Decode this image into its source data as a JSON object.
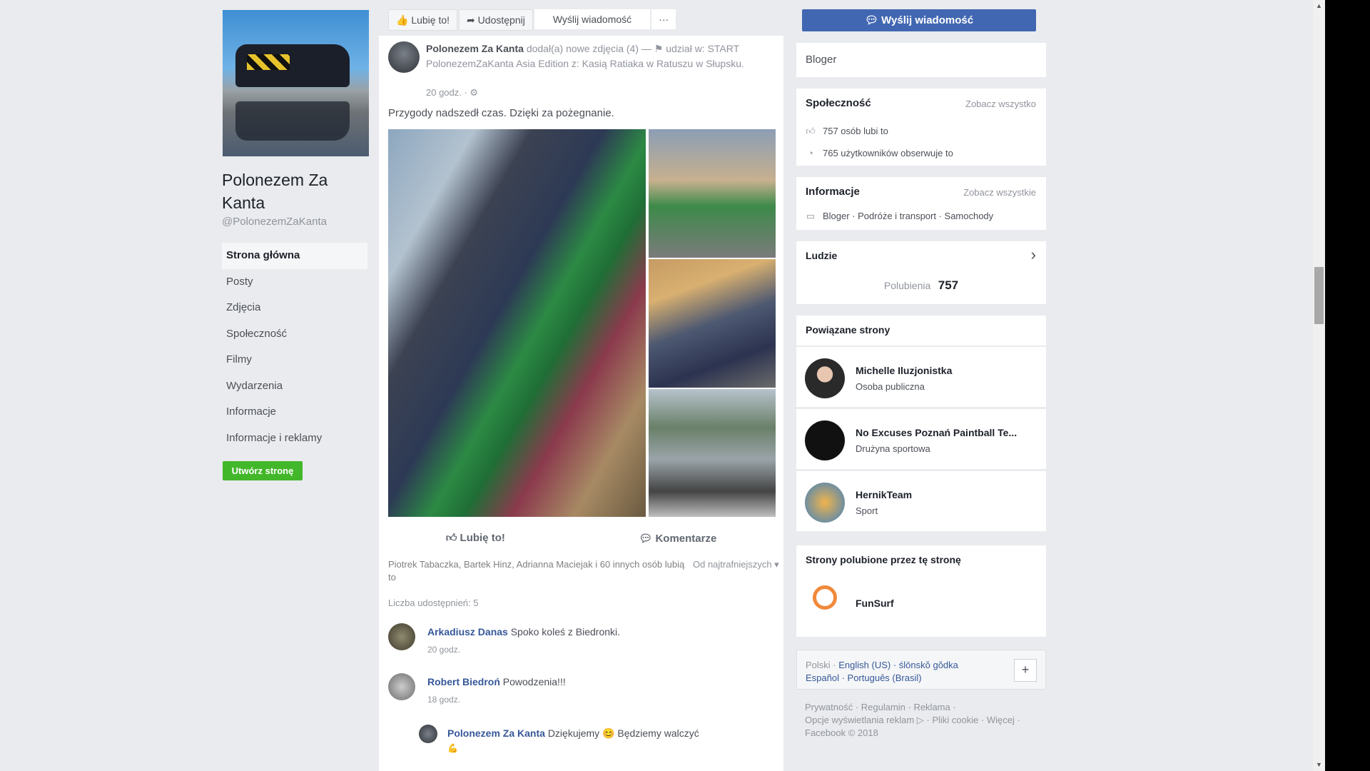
{
  "colors": {
    "accent": "#4267b2",
    "green": "#42b72a",
    "link": "#365899"
  },
  "page": {
    "name": "Polonezem Za Kanta",
    "handle": "@PolonezemZaKanta"
  },
  "nav": {
    "items": [
      "Strona główna",
      "Posty",
      "Zdjęcia",
      "Społeczność",
      "Filmy",
      "Wydarzenia",
      "Informacje",
      "Informacje i reklamy"
    ],
    "active": "Strona główna"
  },
  "create_button": "Utwórz stronę",
  "actionbar": {
    "like": "Lubię to!",
    "share": "Udostępnij",
    "message": "Wyślij wiadomość",
    "more": "···"
  },
  "post": {
    "author": "Polonezem Za Kanta",
    "header_text": "dodał(a) nowe zdjęcia (4) — ⚑ udział w: START PolonezemZaKanta Asia Edition z: Kasią Ratiaka w Ratuszu w Słupsku.",
    "time": "20 godz. · ⚙",
    "text": "Przygody nadszedł czas. Dzięki za pożegnanie.",
    "like_label": "Lubię to!",
    "comment_label": "Komentarze",
    "likes_text": "Piotrek Tabaczka, Bartek Hinz, Adrianna Maciejak i 60 innych osób lubią to",
    "sort_label": "Od najtrafniejszych ▾",
    "shares_text": "Liczba udostępnień: 5",
    "comments": [
      {
        "author": "Arkadiusz Danas",
        "text": "Spoko koleś z Biedronki.",
        "time": "20 godz."
      },
      {
        "author": "Robert Biedroń",
        "text": "Powodzenia!!!",
        "time": "18 godz."
      },
      {
        "author": "Polonezem Za Kanta",
        "text": "Dziękujemy 😊 Będziemy walczyć",
        "time": "💪"
      }
    ]
  },
  "right": {
    "send_button": "Wyślij wiadomość",
    "category": "Bloger",
    "community": {
      "title": "Społeczność",
      "see_all": "Zobacz wszystko",
      "likes": "757 osób lubi to",
      "follows": "765 użytkowników obserwuje to"
    },
    "info": {
      "title": "Informacje",
      "see_all": "Zobacz wszystkie",
      "categories": "Bloger · Podróże i transport · Samochody"
    },
    "people": {
      "title": "Ludzie",
      "likes_label": "Polubienia",
      "likes_value": "757",
      "arrow": "›"
    },
    "related": {
      "title": "Powiązane strony",
      "items": [
        {
          "name": "Michelle Iluzjonistka",
          "sub": "Osoba publiczna"
        },
        {
          "name": "No Excuses Poznań Paintball Te...",
          "sub": "Drużyna sportowa"
        },
        {
          "name": "HernikTeam",
          "sub": "Sport"
        }
      ]
    },
    "liked_by_page": {
      "title": "Strony polubione przez tę stronę",
      "items": [
        {
          "name": "FunSurf"
        }
      ]
    },
    "languages": {
      "prefix": "Polski",
      "items": "English (US) · ślōnskŏ gŏdka",
      "row2": "Español · Português (Brasil)",
      "add": "+"
    },
    "footer": {
      "line1": "Prywatność · Regulamin · Reklama ·",
      "line2": "Opcje wyświetlania reklam ▷ · Pliki cookie · Więcej ·",
      "line3": "Facebook © 2018"
    }
  }
}
